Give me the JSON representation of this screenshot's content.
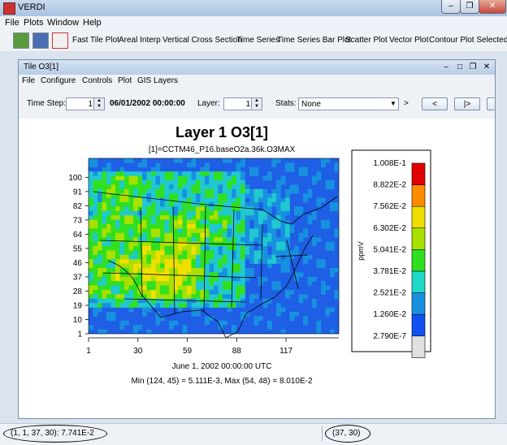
{
  "window": {
    "title": "VERDI"
  },
  "menubar": [
    "File",
    "Plots",
    "Window",
    "Help"
  ],
  "toolbar": {
    "items": [
      "Fast Tile Plot",
      "Areal Interp",
      "Vertical Cross Section",
      "Time Series",
      "Time Series Bar Plot",
      "Scatter Plot",
      "Vector Plot",
      "Contour Plot Selected"
    ]
  },
  "plot_window": {
    "title": "Tile O3[1]",
    "menu": [
      "File",
      "Configure",
      "Controls",
      "Plot",
      "GIS Layers"
    ],
    "time_step_label": "Time Step:",
    "time_step_value": "1",
    "datetime": "06/01/2002 00:00:00",
    "layer_label": "Layer:",
    "layer_value": "1",
    "stats_label": "Stats:",
    "stats_value": "None",
    "gt": ">",
    "prev_label": "<",
    "next_label": "|>"
  },
  "chart_data": {
    "type": "heatmap",
    "title": "Layer 1 O3[1]",
    "subtitle": "[1]=CCTM46_P16.baseO2a.36k.O3MAX",
    "x_ticks": [
      "1",
      "30",
      "59",
      "88",
      "117"
    ],
    "y_ticks": [
      "100",
      "91",
      "82",
      "73",
      "64",
      "55",
      "46",
      "37",
      "28",
      "19",
      "10",
      "1"
    ],
    "xlim": [
      1,
      148
    ],
    "ylim": [
      1,
      112
    ],
    "footer_date": "June 1, 2002 00:00:00 UTC",
    "footer_stats": "Min (124, 45) = 5.111E-3, Max (54, 48) = 8.010E-2",
    "legend_unit": "ppmV",
    "legend_labels": [
      "1.008E-1",
      "8.822E-2",
      "7.562E-2",
      "6.302E-2",
      "5.041E-2",
      "3.781E-2",
      "2.521E-2",
      "1.260E-2",
      "2.790E-7"
    ],
    "legend_colors": [
      "#e00000",
      "#ff8c00",
      "#f0e000",
      "#a8e000",
      "#30e020",
      "#20d8c8",
      "#1890e0",
      "#1050f0",
      "#e0e0e0"
    ]
  },
  "status": {
    "left": "(1, 1, 37, 30): 7.741E-2",
    "right": "(37, 30)"
  }
}
